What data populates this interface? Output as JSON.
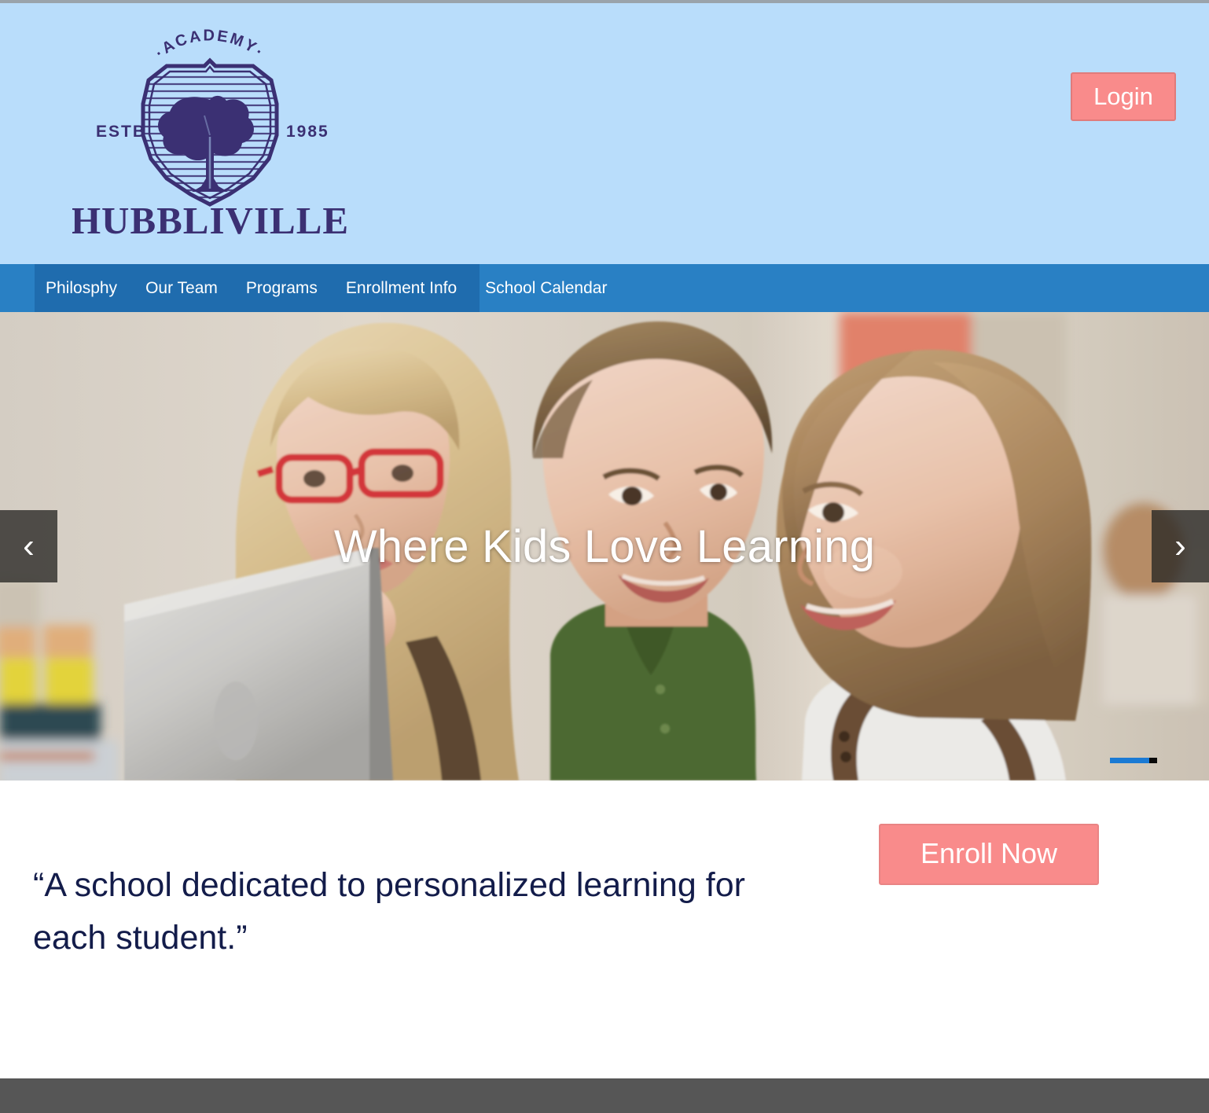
{
  "site": {
    "brand_name": "HUBBLIVILLE",
    "brand_kicker": "·ACADEMY·",
    "brand_estb_label": "ESTB",
    "brand_estb_year": "1985",
    "logo_icon": "shield-tree-crest-icon"
  },
  "header": {
    "background_color": "#b9ddfb",
    "login_label": "Login",
    "login_color": "#f98b8b"
  },
  "nav": {
    "background_color": "#2980c4",
    "active_band_color": "#1f6cae",
    "items": [
      {
        "label": "Philosphy"
      },
      {
        "label": "Our Team"
      },
      {
        "label": "Programs"
      },
      {
        "label": "Enrollment Info"
      },
      {
        "label": "School Calendar"
      }
    ]
  },
  "hero": {
    "title": "Where Kids Love Learning",
    "prev_icon": "chevron-left-icon",
    "next_icon": "chevron-right-icon",
    "prev_glyph": "‹",
    "next_glyph": "›",
    "slides": [
      {
        "indicator": "active",
        "color": "#1a7ad4"
      },
      {
        "indicator": "inactive",
        "color": "#0a0a0a"
      }
    ]
  },
  "main": {
    "quote": "“A school dedicated to personalized learning for each student.”",
    "quote_color": "#131c4a",
    "enroll_label": "Enroll Now",
    "enroll_color": "#f98b8b"
  },
  "footer": {
    "background_color": "#565656"
  }
}
